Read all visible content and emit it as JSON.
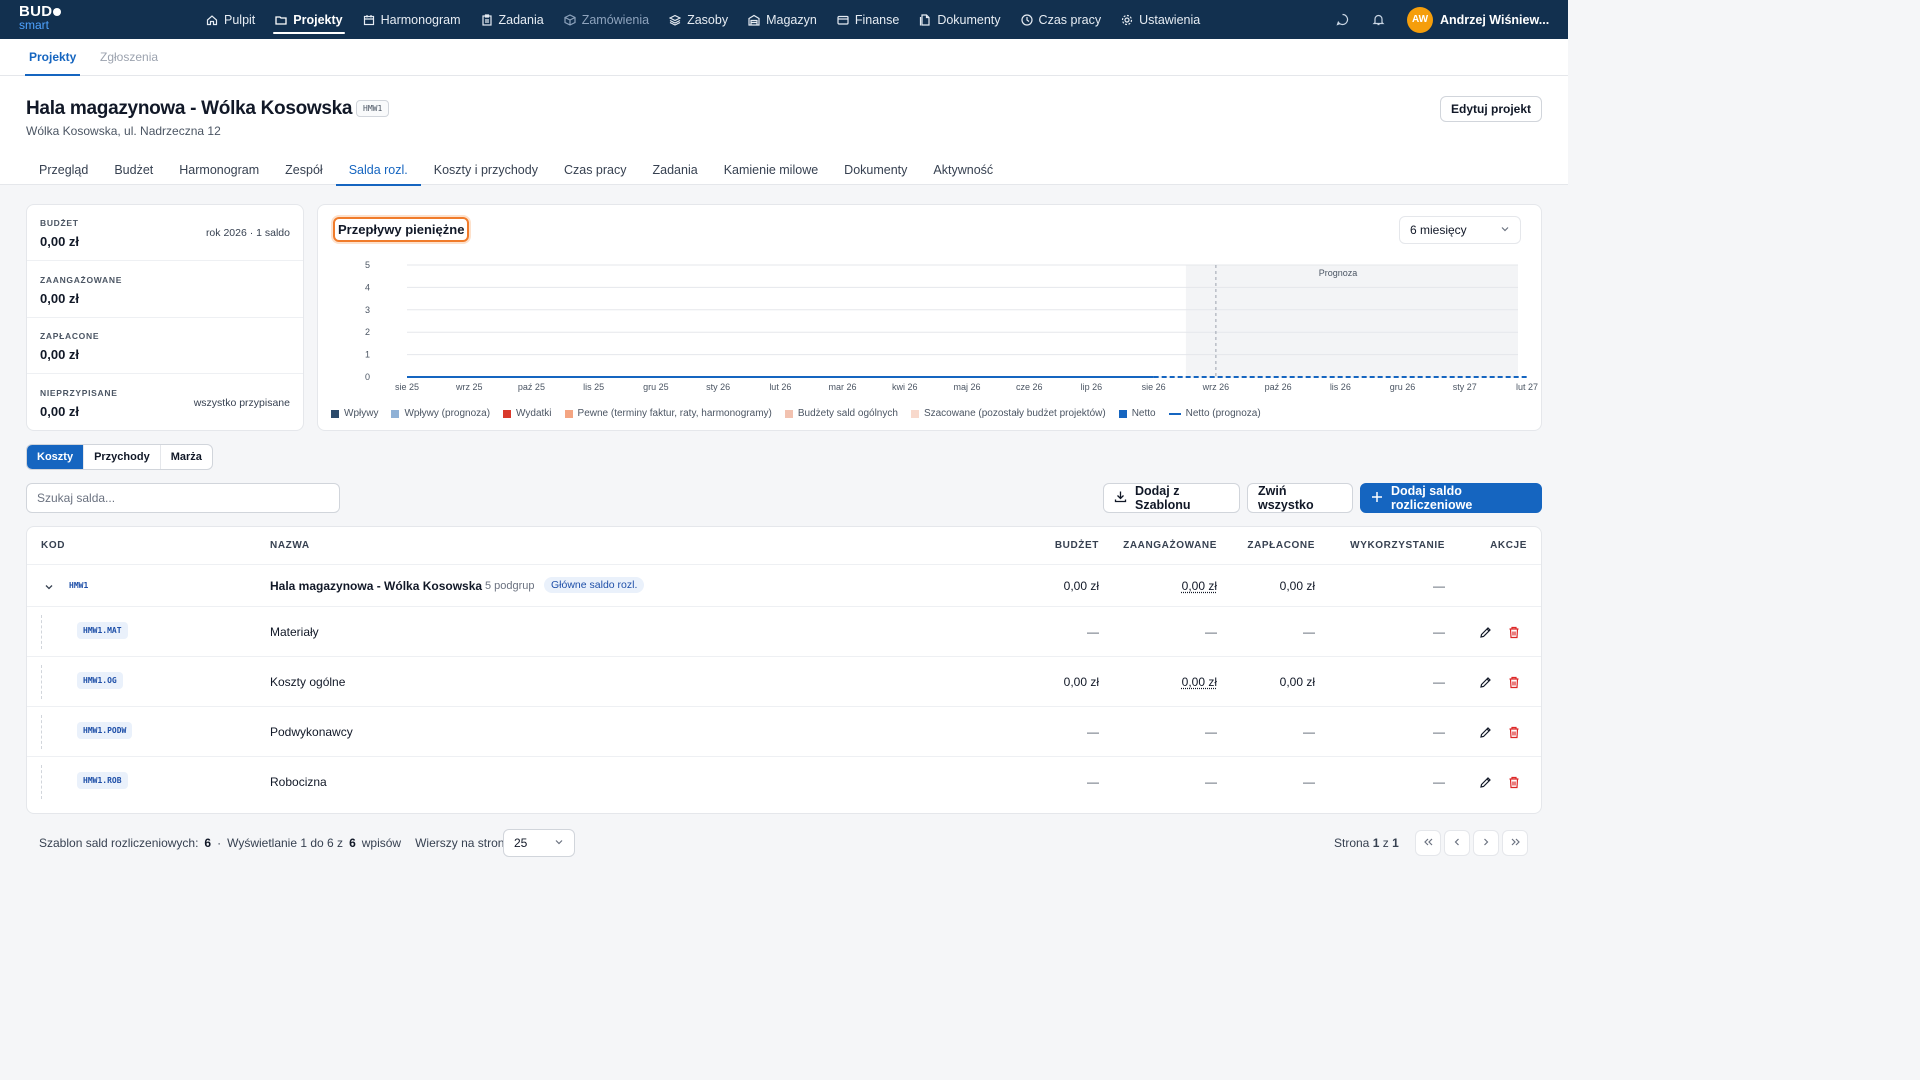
{
  "app": {
    "logo_top": "BUD",
    "logo_bottom": "smart",
    "nav": [
      {
        "label": "Pulpit",
        "icon": "home-icon"
      },
      {
        "label": "Projekty",
        "icon": "folder-icon"
      },
      {
        "label": "Harmonogram",
        "icon": "calendar-icon"
      },
      {
        "label": "Zadania",
        "icon": "clipboard-icon"
      },
      {
        "label": "Zamówienia",
        "icon": "box-icon"
      },
      {
        "label": "Zasoby",
        "icon": "layers-icon"
      },
      {
        "label": "Magazyn",
        "icon": "warehouse-icon"
      },
      {
        "label": "Finanse",
        "icon": "wallet-icon"
      },
      {
        "label": "Dokumenty",
        "icon": "documents-icon"
      },
      {
        "label": "Czas pracy",
        "icon": "clock-icon"
      },
      {
        "label": "Ustawienia",
        "icon": "gear-icon"
      }
    ],
    "user": {
      "initials": "AW",
      "name": "Andrzej Wiśniew..."
    }
  },
  "subnav": [
    "Projekty",
    "Zgłoszenia"
  ],
  "project": {
    "title": "Hala magazynowa - Wólka Kosowska",
    "code": "HMW1",
    "address": "Wólka Kosowska, ul. Nadrzeczna 12",
    "edit_label": "Edytuj projekt",
    "tabs": [
      "Przegląd",
      "Budżet",
      "Harmonogram",
      "Zespół",
      "Salda rozl.",
      "Koszty i przychody",
      "Czas pracy",
      "Zadania",
      "Kamienie milowe",
      "Dokumenty",
      "Aktywność"
    ]
  },
  "summary": [
    {
      "label": "BUDŻET",
      "value": "0,00 zł",
      "note": "rok 2026 · 1 saldo"
    },
    {
      "label": "ZAANGAŻOWANE",
      "value": "0,00 zł",
      "note": ""
    },
    {
      "label": "ZAPŁACONE",
      "value": "0,00 zł",
      "note": ""
    },
    {
      "label": "NIEPRZYPISANE",
      "value": "0,00 zł",
      "note": "wszystko przypisane"
    }
  ],
  "chart": {
    "title": "Przepływy pieniężne",
    "period": "6 miesięcy",
    "forecast_label": "Prognoza"
  },
  "chart_data": {
    "type": "line",
    "categories": [
      "sie 25",
      "wrz 25",
      "paź 25",
      "lis 25",
      "gru 25",
      "sty 26",
      "lut 26",
      "mar 26",
      "kwi 26",
      "maj 26",
      "cze 26",
      "lip 26",
      "sie 26",
      "wrz 26",
      "paź 26",
      "lis 26",
      "gru 26",
      "sty 27",
      "lut 27"
    ],
    "y_ticks": [
      0,
      1,
      2,
      3,
      4,
      5
    ],
    "ylim": [
      0,
      5
    ],
    "forecast_start": "wrz 26",
    "series": [
      {
        "name": "Wpływy",
        "color": "#2c4a6b",
        "values": [
          0,
          0,
          0,
          0,
          0,
          0,
          0,
          0,
          0,
          0,
          0,
          0,
          0,
          null,
          null,
          null,
          null,
          null,
          null
        ]
      },
      {
        "name": "Wpływy (prognoza)",
        "color": "#8fb1d6",
        "values": [
          null,
          null,
          null,
          null,
          null,
          null,
          null,
          null,
          null,
          null,
          null,
          null,
          null,
          0,
          0,
          0,
          0,
          0,
          0
        ]
      },
      {
        "name": "Wydatki",
        "color": "#d9392b",
        "values": [
          0,
          0,
          0,
          0,
          0,
          0,
          0,
          0,
          0,
          0,
          0,
          0,
          0,
          null,
          null,
          null,
          null,
          null,
          null
        ]
      },
      {
        "name": "Pewne (terminy faktur, raty, harmonogramy)",
        "color": "#f4a582",
        "values": [
          null,
          null,
          null,
          null,
          null,
          null,
          null,
          null,
          null,
          null,
          null,
          null,
          null,
          0,
          0,
          0,
          0,
          0,
          0
        ]
      },
      {
        "name": "Budżety sald ogólnych",
        "color": "#f2c2b0",
        "values": [
          null,
          null,
          null,
          null,
          null,
          null,
          null,
          null,
          null,
          null,
          null,
          null,
          null,
          0,
          0,
          0,
          0,
          0,
          0
        ]
      },
      {
        "name": "Szacowane (pozostały budżet projektów)",
        "color": "#f8d9cc",
        "values": [
          null,
          null,
          null,
          null,
          null,
          null,
          null,
          null,
          null,
          null,
          null,
          null,
          null,
          0,
          0,
          0,
          0,
          0,
          0
        ]
      },
      {
        "name": "Netto",
        "color": "#1565c0",
        "values": [
          0,
          0,
          0,
          0,
          0,
          0,
          0,
          0,
          0,
          0,
          0,
          0,
          0,
          null,
          null,
          null,
          null,
          null,
          null
        ]
      },
      {
        "name": "Netto (prognoza)",
        "color": "#1565c0",
        "values": [
          null,
          null,
          null,
          null,
          null,
          null,
          null,
          null,
          null,
          null,
          null,
          null,
          0,
          0,
          0,
          0,
          0,
          0,
          0
        ]
      }
    ]
  },
  "toggle": [
    "Koszty",
    "Przychody",
    "Marża"
  ],
  "search_placeholder": "Szukaj salda...",
  "actions": {
    "template": "Dodaj z Szablonu",
    "collapse": "Zwiń wszystko",
    "add": "Dodaj saldo rozliczeniowe"
  },
  "table": {
    "headers": [
      "KOD",
      "NAZWA",
      "BUDŻET",
      "ZAANGAŻOWANE",
      "ZAPŁACONE",
      "WYKORZYSTANIE",
      "AKCJE"
    ],
    "parent": {
      "code": "HMW1",
      "name": "Hala magazynowa - Wólka Kosowska",
      "subgroups": "5 podgrup",
      "badge": "Główne saldo rozl.",
      "budget": "0,00 zł",
      "committed": "0,00 zł",
      "paid": "0,00 zł",
      "usage": "—"
    },
    "rows": [
      {
        "code": "HMW1.MAT",
        "name": "Materiały",
        "budget": "—",
        "committed": "—",
        "paid": "—",
        "usage": "—"
      },
      {
        "code": "HMW1.OG",
        "name": "Koszty ogólne",
        "budget": "0,00 zł",
        "committed": "0,00 zł",
        "paid": "0,00 zł",
        "usage": "—"
      },
      {
        "code": "HMW1.PODW",
        "name": "Podwykonawcy",
        "budget": "—",
        "committed": "—",
        "paid": "—",
        "usage": "—"
      },
      {
        "code": "HMW1.ROB",
        "name": "Robocizna",
        "budget": "—",
        "committed": "—",
        "paid": "—",
        "usage": "—"
      }
    ]
  },
  "footer": {
    "template_label": "Szablon sald rozliczeniowych:",
    "template_count": "6",
    "display_prefix": "Wyświetlanie 1 do 6 z",
    "display_total": "6",
    "display_suffix": "wpisów",
    "rows_label": "Wierszy na stronę",
    "rows_value": "25",
    "page_prefix": "Strona",
    "page_current": "1",
    "page_of": "z",
    "page_total": "1"
  }
}
